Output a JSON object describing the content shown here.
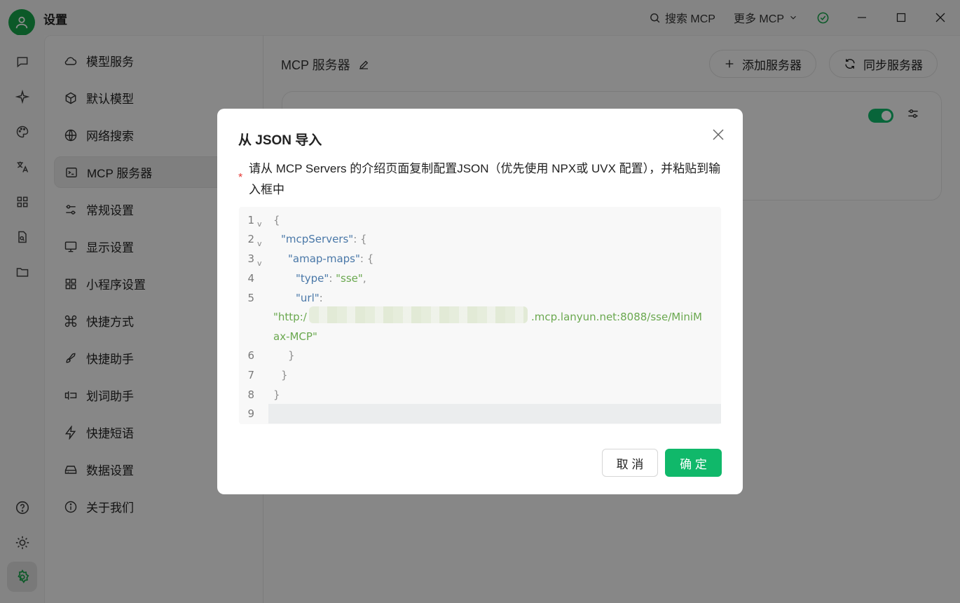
{
  "app": {
    "title": "设置"
  },
  "titlebar": {
    "search_mcp": "搜索 MCP",
    "more_mcp": "更多 MCP",
    "status_color": "#16a34a"
  },
  "rail": {
    "items": [
      "chat-icon",
      "sparkle-icon",
      "palette-icon",
      "translate-icon",
      "apps-icon",
      "file-search-icon",
      "folder-icon"
    ],
    "bottom": [
      "help-icon",
      "brightness-icon",
      "settings-icon"
    ]
  },
  "nav": {
    "items": [
      {
        "label": "模型服务",
        "icon": "cloud-icon"
      },
      {
        "label": "默认模型",
        "icon": "cube-icon"
      },
      {
        "label": "网络搜索",
        "icon": "globe-icon"
      },
      {
        "label": "MCP 服务器",
        "icon": "terminal-icon",
        "active": true
      },
      {
        "label": "常规设置",
        "icon": "sliders-icon"
      },
      {
        "label": "显示设置",
        "icon": "monitor-icon"
      },
      {
        "label": "小程序设置",
        "icon": "grid-icon"
      },
      {
        "label": "快捷方式",
        "icon": "command-icon"
      },
      {
        "label": "快捷助手",
        "icon": "rocket-icon"
      },
      {
        "label": "划词助手",
        "icon": "text-cursor-icon"
      },
      {
        "label": "快捷短语",
        "icon": "zap-icon"
      },
      {
        "label": "数据设置",
        "icon": "drive-icon"
      },
      {
        "label": "关于我们",
        "icon": "info-icon"
      }
    ]
  },
  "main": {
    "title": "MCP 服务器",
    "add_button": "添加服务器",
    "sync_button": "同步服务器"
  },
  "dialog": {
    "title": "从 JSON 导入",
    "description": "请从 MCP Servers 的介绍页面复制配置JSON（优先使用 NPX或 UVX 配置），并粘贴到输入框中",
    "required_mark": "*",
    "editor": {
      "line_numbers": [
        "1",
        "2",
        "3",
        "4",
        "5",
        "6",
        "7",
        "8",
        "9"
      ],
      "l1": "{",
      "l2_key": "\"mcpServers\"",
      "l2_rest": ": {",
      "l3_key": "\"amap-maps\"",
      "l3_rest": ": {",
      "l4_key": "\"type\"",
      "l4_sep": ": ",
      "l4_val": "\"sse\"",
      "l4_end": ",",
      "l5_key": "\"url\"",
      "l5_sep": ":",
      "l5_val_a": "\"http:/",
      "l5_val_b": ".mcp.lanyun.net:8088/sse/MiniM",
      "l5_val_c": "ax-MCP\"",
      "l6": "}",
      "l7": "}",
      "l8": "}"
    },
    "cancel": "取 消",
    "confirm": "确 定",
    "accent": "#10b86a"
  }
}
